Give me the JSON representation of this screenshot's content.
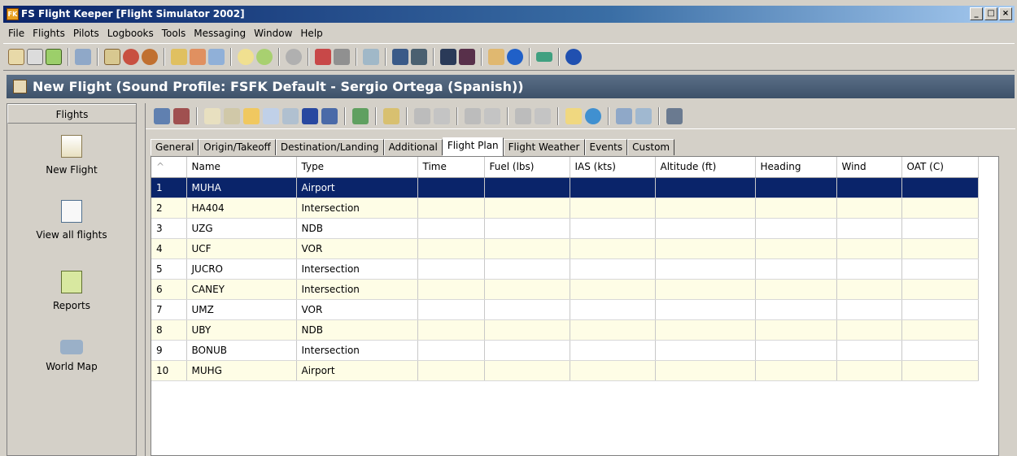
{
  "window": {
    "title": "FS Flight Keeper [Flight Simulator 2002]",
    "app_icon": "FK"
  },
  "menu": [
    "File",
    "Flights",
    "Pilots",
    "Logbooks",
    "Tools",
    "Messaging",
    "Window",
    "Help"
  ],
  "page_header": "New Flight (Sound Profile: FSFK Default - Sergio Ortega (Spanish))",
  "sidebar": {
    "title": "Flights",
    "items": [
      {
        "label": "New Flight",
        "icon": "new-flight-icon"
      },
      {
        "label": "View all flights",
        "icon": "view-all-flights-icon"
      },
      {
        "label": "Reports",
        "icon": "reports-icon"
      },
      {
        "label": "World Map",
        "icon": "world-map-icon"
      }
    ]
  },
  "tabs": [
    "General",
    "Origin/Takeoff",
    "Destination/Landing",
    "Additional",
    "Flight Plan",
    "Flight Weather",
    "Events",
    "Custom"
  ],
  "active_tab": "Flight Plan",
  "table": {
    "sort_indicator": "^",
    "columns": [
      "Name",
      "Type",
      "Time",
      "Fuel (lbs)",
      "IAS (kts)",
      "Altitude (ft)",
      "Heading",
      "Wind",
      "OAT (C)"
    ],
    "rows": [
      {
        "n": "1",
        "name": "MUHA",
        "type": "Airport"
      },
      {
        "n": "2",
        "name": "HA404",
        "type": "Intersection"
      },
      {
        "n": "3",
        "name": "UZG",
        "type": "NDB"
      },
      {
        "n": "4",
        "name": "UCF",
        "type": "VOR"
      },
      {
        "n": "5",
        "name": "JUCRO",
        "type": "Intersection"
      },
      {
        "n": "6",
        "name": "CANEY",
        "type": "Intersection"
      },
      {
        "n": "7",
        "name": "UMZ",
        "type": "VOR"
      },
      {
        "n": "8",
        "name": "UBY",
        "type": "NDB"
      },
      {
        "n": "9",
        "name": "BONUB",
        "type": "Intersection"
      },
      {
        "n": "10",
        "name": "MUHG",
        "type": "Airport"
      }
    ],
    "selected_row": "1"
  },
  "colors": {
    "selection": "#0a246a",
    "row_alt": "#fefde6",
    "header_band": "#4a5f78"
  }
}
